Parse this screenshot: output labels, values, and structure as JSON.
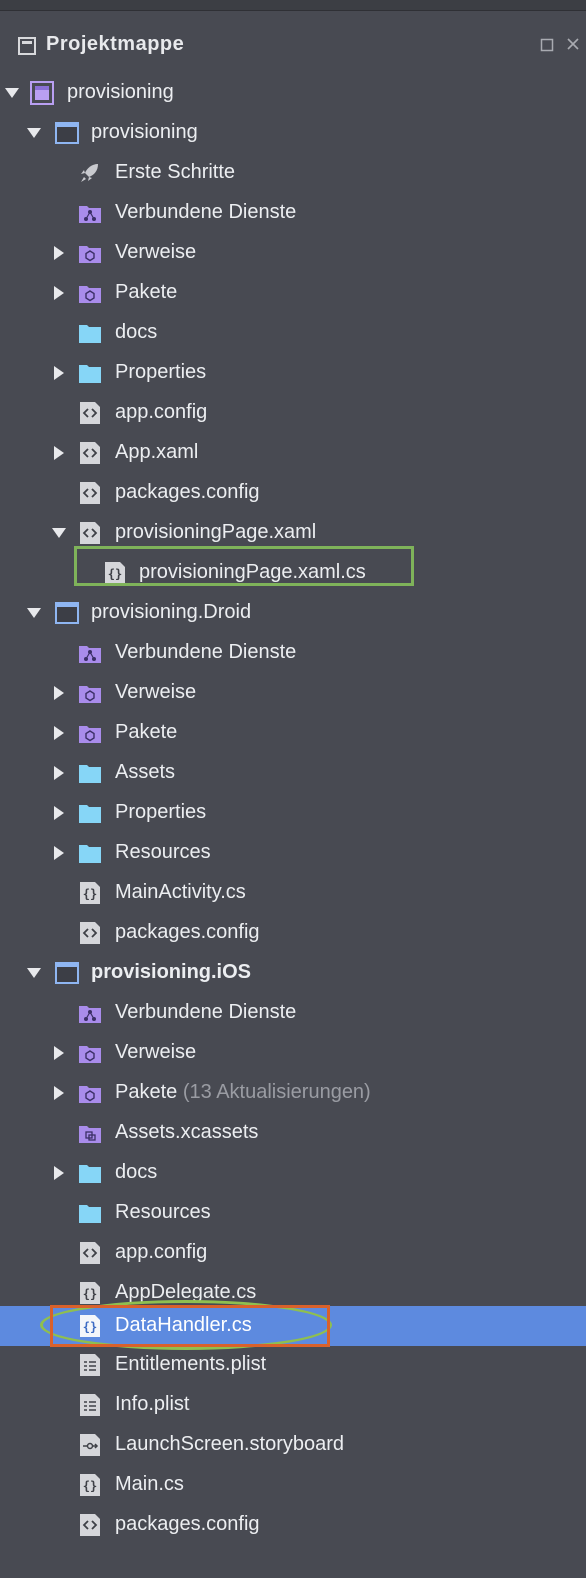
{
  "header": {
    "title": "Projektmappe"
  },
  "tree": {
    "solution": {
      "label": "provisioning"
    },
    "projects": [
      {
        "label": "provisioning",
        "items": [
          {
            "label": "Erste Schritte"
          },
          {
            "label": "Verbundene Dienste"
          },
          {
            "label": "Verweise"
          },
          {
            "label": "Pakete"
          },
          {
            "label": "docs"
          },
          {
            "label": "Properties"
          },
          {
            "label": "app.config"
          },
          {
            "label": "App.xaml"
          },
          {
            "label": "packages.config"
          },
          {
            "label": "provisioningPage.xaml"
          },
          {
            "label": "provisioningPage.xaml.cs"
          }
        ]
      },
      {
        "label": "provisioning.Droid",
        "items": [
          {
            "label": "Verbundene Dienste"
          },
          {
            "label": "Verweise"
          },
          {
            "label": "Pakete"
          },
          {
            "label": "Assets"
          },
          {
            "label": "Properties"
          },
          {
            "label": "Resources"
          },
          {
            "label": "MainActivity.cs"
          },
          {
            "label": "packages.config"
          }
        ]
      },
      {
        "label": "provisioning.iOS",
        "items": [
          {
            "label": "Verbundene Dienste"
          },
          {
            "label": "Verweise"
          },
          {
            "label": "Pakete",
            "note": "(13 Aktualisierungen)"
          },
          {
            "label": "Assets.xcassets"
          },
          {
            "label": "docs"
          },
          {
            "label": "Resources"
          },
          {
            "label": "app.config"
          },
          {
            "label": "AppDelegate.cs"
          },
          {
            "label": "DataHandler.cs"
          },
          {
            "label": "Entitlements.plist"
          },
          {
            "label": "Info.plist"
          },
          {
            "label": "LaunchScreen.storyboard"
          },
          {
            "label": "Main.cs"
          },
          {
            "label": "packages.config"
          }
        ]
      }
    ]
  },
  "colors": {
    "background": "#484a52",
    "selection": "#5d8adf",
    "highlight_green": "#7fb35a",
    "highlight_orange": "#d9612b"
  }
}
